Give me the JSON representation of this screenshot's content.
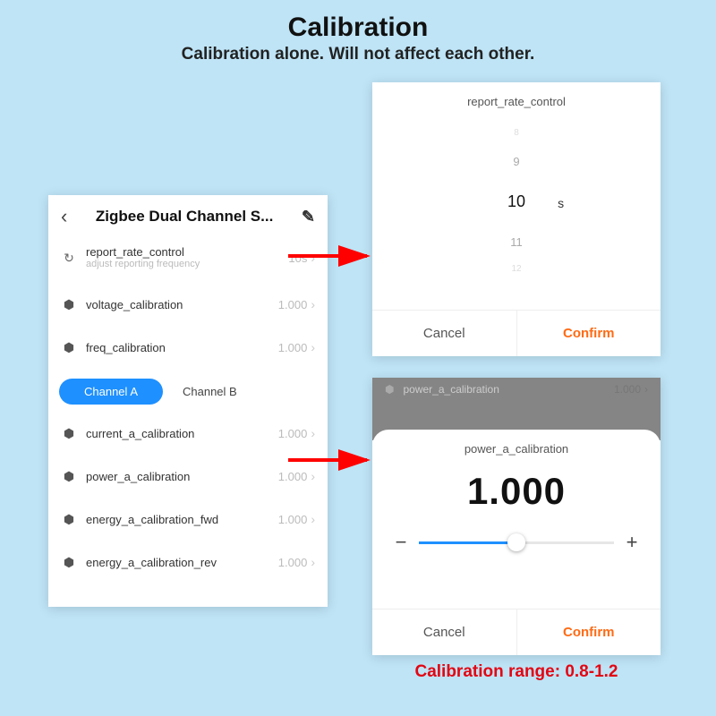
{
  "header": {
    "title": "Calibration",
    "subtitle": "Calibration alone. Will not affect each other."
  },
  "phone": {
    "title": "Zigbee Dual Channel S...",
    "rows": {
      "report": {
        "label": "report_rate_control",
        "sub": "adjust reporting frequency",
        "value": "10s"
      },
      "voltage": {
        "label": "voltage_calibration",
        "value": "1.000"
      },
      "freq": {
        "label": "freq_calibration",
        "value": "1.000"
      },
      "cur_a": {
        "label": "current_a_calibration",
        "value": "1.000"
      },
      "pow_a": {
        "label": "power_a_calibration",
        "value": "1.000"
      },
      "en_fwd": {
        "label": "energy_a_calibration_fwd",
        "value": "1.000"
      },
      "en_rev": {
        "label": "energy_a_calibration_rev",
        "value": "1.000"
      }
    },
    "tabs": {
      "a": "Channel A",
      "b": "Channel B"
    }
  },
  "picker": {
    "title": "report_rate_control",
    "options": {
      "o1": "8",
      "o2": "9",
      "sel": "10",
      "o4": "11",
      "o5": "12"
    },
    "unit": "s",
    "cancel": "Cancel",
    "confirm": "Confirm"
  },
  "sheet": {
    "bgrow": {
      "label": "power_a_calibration",
      "value": "1.000"
    },
    "title": "power_a_calibration",
    "value": "1.000",
    "cancel": "Cancel",
    "confirm": "Confirm"
  },
  "range": "Calibration range: 0.8-1.2"
}
